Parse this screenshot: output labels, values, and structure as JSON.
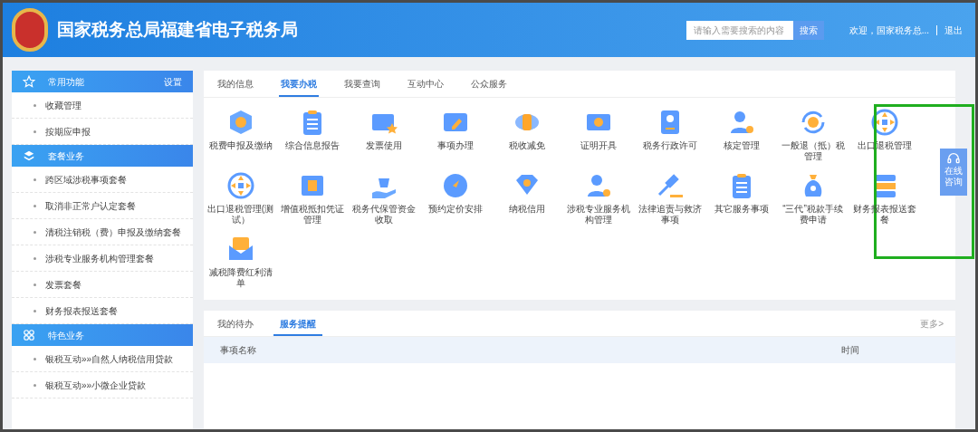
{
  "header": {
    "title": "国家税务总局福建省电子税务局",
    "search": {
      "placeholder": "请输入需要搜索的内容",
      "button": "搜索"
    },
    "welcome": "欢迎，国家税务总...",
    "logout": "退出"
  },
  "sidebar": [
    {
      "title": "常用功能",
      "action": "设置",
      "items": [
        "收藏管理",
        "按期应申报"
      ]
    },
    {
      "title": "套餐业务",
      "items": [
        "跨区域涉税事项套餐",
        "取消非正常户认定套餐",
        "清税注销税（费）申报及缴纳套餐",
        "涉税专业服务机构管理套餐",
        "发票套餐",
        "财务报表报送套餐"
      ]
    },
    {
      "title": "特色业务",
      "items": [
        "银税互动»»自然人纳税信用贷款",
        "银税互动»»小微企业贷款"
      ]
    }
  ],
  "main_tabs": [
    {
      "label": "我的信息",
      "selected": false
    },
    {
      "label": "我要办税",
      "selected": true
    },
    {
      "label": "我要查询",
      "selected": false
    },
    {
      "label": "互动中心",
      "selected": false
    },
    {
      "label": "公众服务",
      "selected": false
    }
  ],
  "services": [
    "税费申报及缴纳",
    "综合信息报告",
    "发票使用",
    "事项办理",
    "税收减免",
    "证明开具",
    "税务行政许可",
    "核定管理",
    "一般退（抵）税管理",
    "出口退税管理",
    "出口退税管理(测试）",
    "增值税抵扣凭证管理",
    "税务代保管资金收取",
    "预约定价安排",
    "纳税信用",
    "涉税专业服务机构管理",
    "法律追责与救济事项",
    "其它服务事项",
    "“三代”税款手续费申请",
    "财务报表报送套餐",
    "减税降费红利清单"
  ],
  "reminder": {
    "tabs": [
      {
        "label": "我的待办",
        "selected": false
      },
      {
        "label": "服务提醒",
        "selected": true
      }
    ],
    "more": "更多>",
    "columns": [
      "事项名称",
      "时间"
    ]
  },
  "consult": "在线咨询"
}
